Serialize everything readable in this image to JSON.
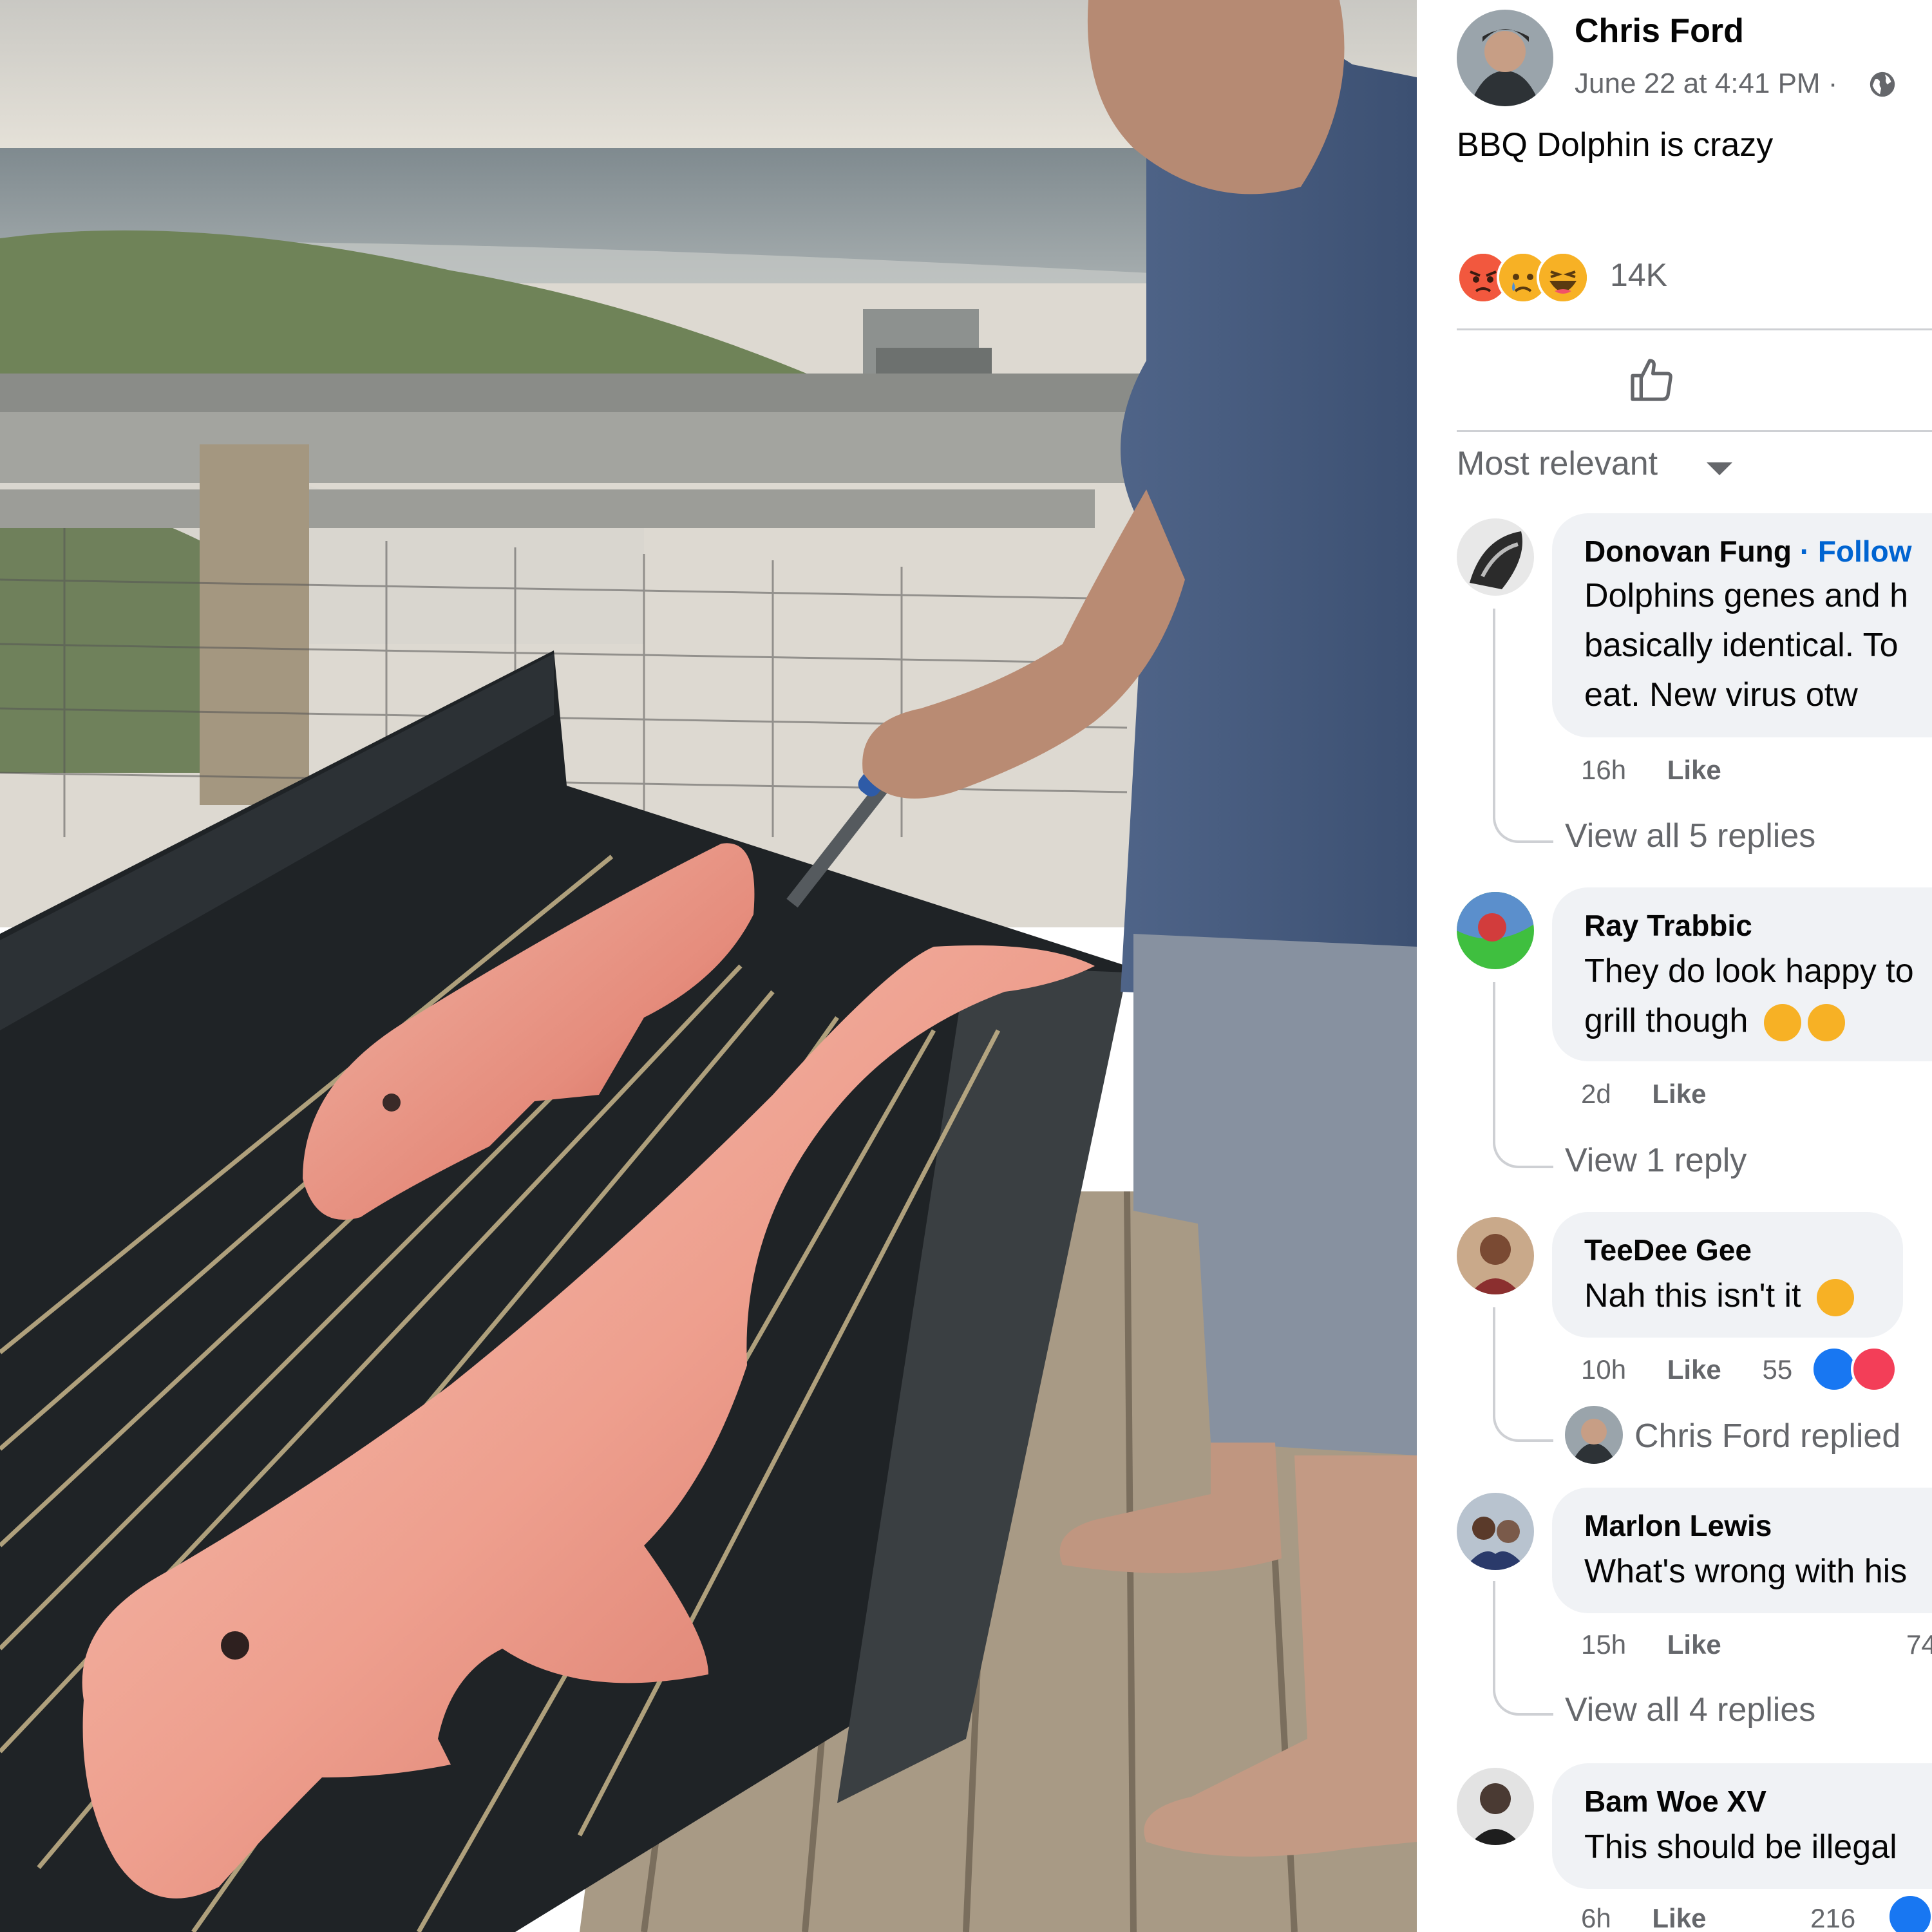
{
  "post": {
    "author": "Chris Ford",
    "timestamp": "June 22 at 4:41 PM · ",
    "privacy_icon": "globe-icon",
    "text": "BBQ Dolphin is crazy",
    "reactions": {
      "types": [
        "angry",
        "sad",
        "haha"
      ],
      "count": "14K"
    }
  },
  "actions": {
    "like_icon": "thumbs-up-icon"
  },
  "sort": {
    "label": "Most relevant"
  },
  "comments": [
    {
      "author": "Donovan Fung",
      "follow": " · Follow",
      "lines": [
        "Dolphins genes and h",
        "basically identical. To",
        "eat. New virus otw"
      ],
      "time": "16h",
      "like": "Like",
      "view_replies": "View all 5 replies"
    },
    {
      "author": "Ray Trabbic",
      "lines": [
        "They do look happy to",
        "grill though"
      ],
      "time": "2d",
      "like": "Like",
      "view_replies": "View 1 reply"
    },
    {
      "author": "TeeDee Gee",
      "lines": [
        "Nah this isn't it"
      ],
      "time": "10h",
      "like": "Like",
      "reaction_count": "55",
      "reply_preview": "Chris Ford replied"
    },
    {
      "author": "Marlon Lewis",
      "lines": [
        "What's wrong with his"
      ],
      "time": "15h",
      "like": "Like",
      "reaction_count": "74",
      "view_replies": "View all 4 replies"
    },
    {
      "author": "Bam Woe XV",
      "lines": [
        "This should be illegal"
      ],
      "time": "6h",
      "like": "Like",
      "reaction_count": "216"
    }
  ],
  "colors": {
    "facebook_blue": "#0064d1",
    "secondary_text": "#65676b",
    "bubble_bg": "#f0f2f5",
    "divider": "#ced0d4"
  }
}
